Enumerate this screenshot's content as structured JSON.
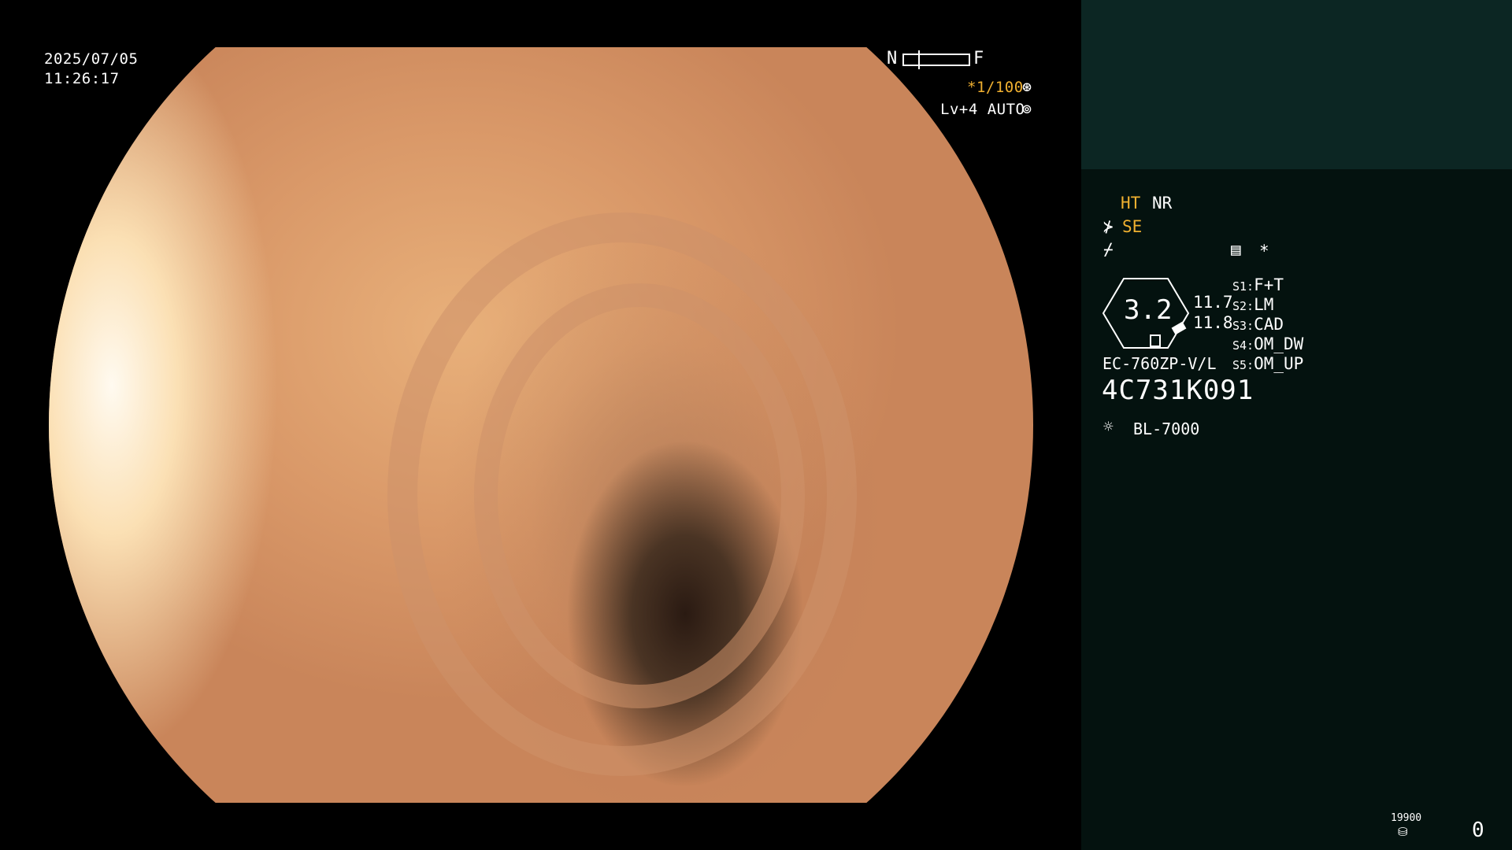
{
  "viewport": {
    "date": "2025/07/05",
    "time": "11:26:17",
    "nf_left": "N",
    "nf_right": "F",
    "shutter": "*1/100",
    "shutter_icon": "aperture-icon",
    "level": "Lv+4 AUTO",
    "level_icon": "iris-icon"
  },
  "panel": {
    "mode_ht": "HT",
    "mode_nr": "NR",
    "se_icon": "scope-angle-icon",
    "se": "SE",
    "enhance_icon": "enhance-icon",
    "record_icon": "recorder-icon",
    "asterisk": "*",
    "zoom_value": "3.2",
    "zoom_a": "11.7",
    "zoom_b": "11.8",
    "switches": [
      {
        "key": "S1:",
        "value": "F+T"
      },
      {
        "key": "S2:",
        "value": "LM"
      },
      {
        "key": "S3:",
        "value": "CAD"
      },
      {
        "key": "S4:",
        "value": "OM_DW"
      },
      {
        "key": "S5:",
        "value": "OM_UP"
      }
    ],
    "scope_model": "EC-760ZP-V/L",
    "serial": "4C731K091",
    "light_icon": "light-source-icon",
    "light_source": "BL-7000",
    "disk_count": "19900",
    "disk_icon": "disk-icon",
    "counter": "0"
  }
}
